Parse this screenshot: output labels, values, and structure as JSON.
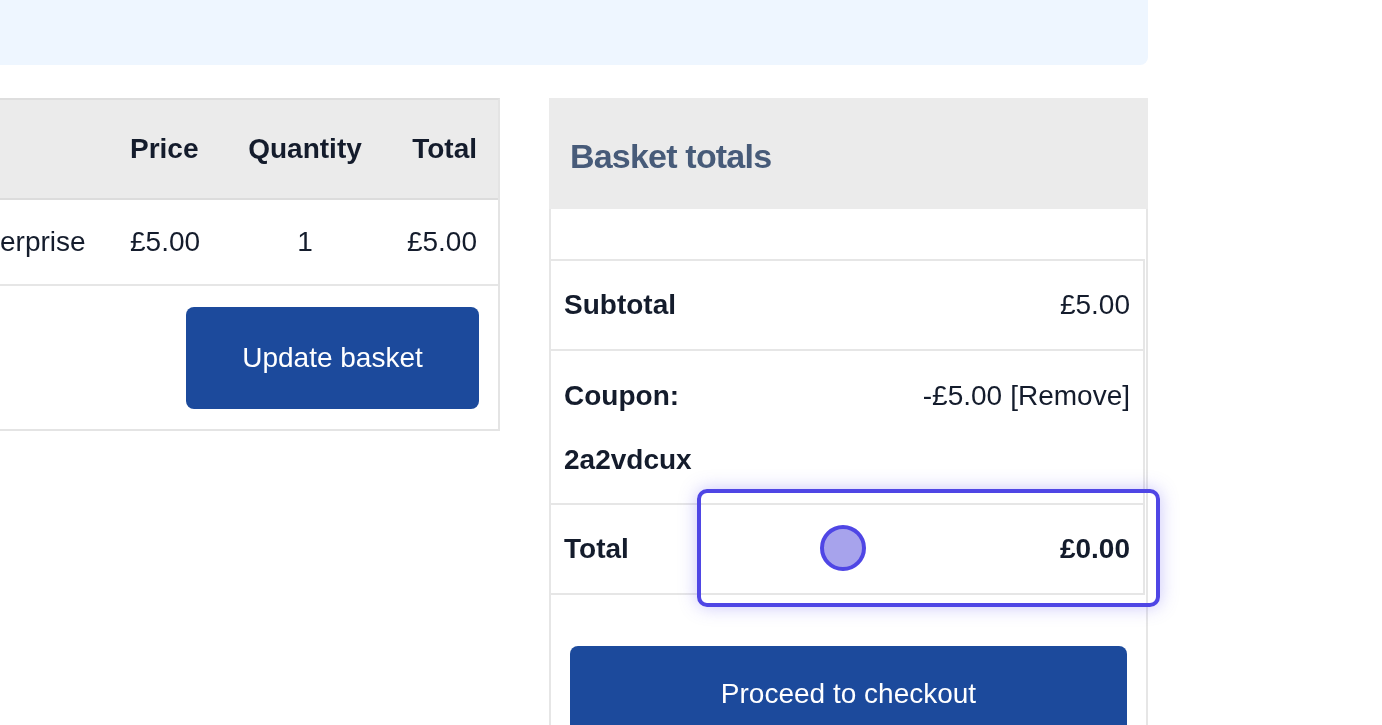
{
  "basket_table": {
    "columns": [
      "Price",
      "Quantity",
      "Total"
    ],
    "rows": [
      {
        "product": "erprise",
        "price": "£5.00",
        "quantity": "1",
        "total": "£5.00"
      }
    ],
    "update_button": "Update basket"
  },
  "basket_totals": {
    "title": "Basket totals",
    "rows": [
      {
        "kind": "plain",
        "label": "Subtotal",
        "value": "£5.00",
        "highlighted": false
      },
      {
        "kind": "coupon",
        "label": "Coupon:",
        "code": "2a2vdcux",
        "value": "-£5.00",
        "link": "[Remove]",
        "highlighted": false
      },
      {
        "kind": "total",
        "label": "Total",
        "value": "£0.00",
        "highlighted": true
      }
    ],
    "checkout_button": "Proceed to checkout"
  }
}
